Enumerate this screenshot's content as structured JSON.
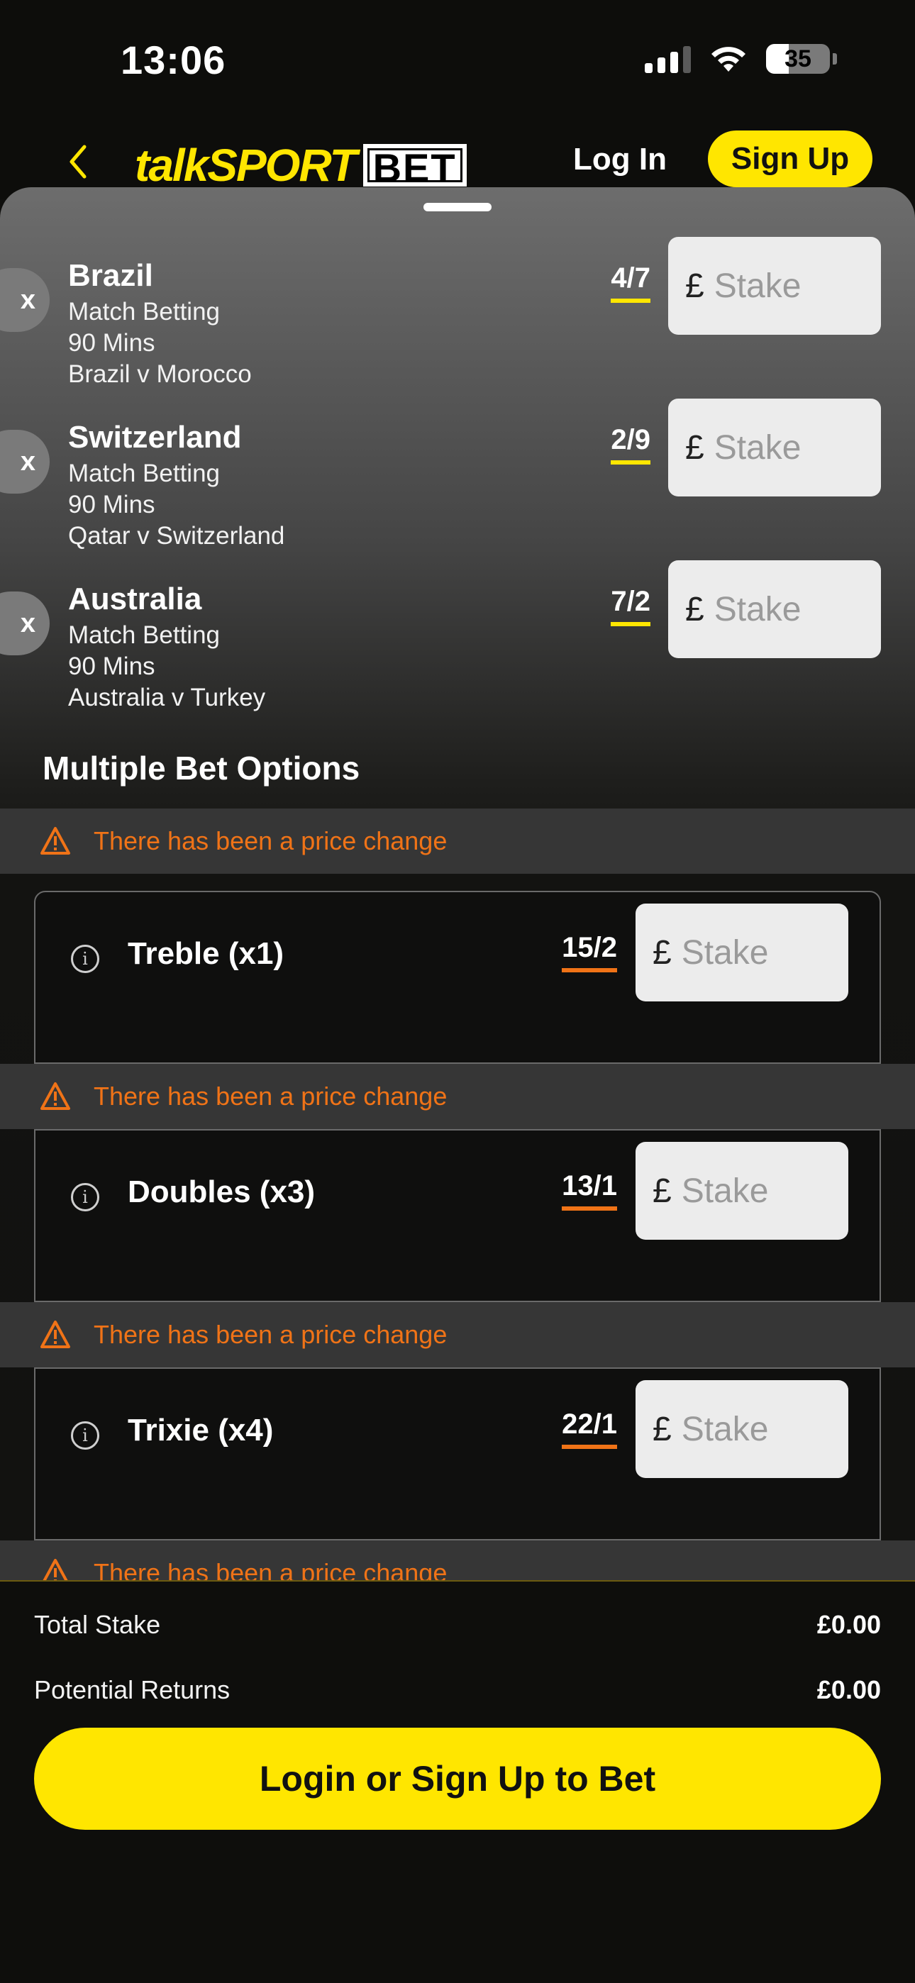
{
  "status_bar": {
    "time": "13:06",
    "battery": "35"
  },
  "header": {
    "back_icon": "chevron-left-icon",
    "logo_talk": "talkSPORT",
    "logo_bet": "BET",
    "login": "Log In",
    "signup": "Sign Up"
  },
  "colors": {
    "brand_yellow": "#ffe600",
    "warning_orange": "#f07317",
    "background": "#0e0e0c"
  },
  "selections": [
    {
      "team": "Brazil",
      "market": "Match Betting",
      "period": "90 Mins",
      "event": "Brazil v Morocco",
      "odds": "4/7",
      "remove": "x",
      "stake_symbol": "£",
      "stake_placeholder": "Stake"
    },
    {
      "team": "Switzerland",
      "market": "Match Betting",
      "period": "90 Mins",
      "event": "Qatar v Switzerland",
      "odds": "2/9",
      "remove": "x",
      "stake_symbol": "£",
      "stake_placeholder": "Stake"
    },
    {
      "team": "Australia",
      "market": "Match Betting",
      "period": "90 Mins",
      "event": "Australia v Turkey",
      "odds": "7/2",
      "remove": "x",
      "stake_symbol": "£",
      "stake_placeholder": "Stake"
    }
  ],
  "multiples": {
    "title": "Multiple Bet Options",
    "warning_text": "There has been a price change",
    "bets": [
      {
        "name": "Treble (x1)",
        "odds": "15/2",
        "stake_symbol": "£",
        "stake_placeholder": "Stake"
      },
      {
        "name": "Doubles (x3)",
        "odds": "13/1",
        "stake_symbol": "£",
        "stake_placeholder": "Stake"
      },
      {
        "name": "Trixie (x4)",
        "odds": "22/1",
        "stake_symbol": "£",
        "stake_placeholder": "Stake"
      }
    ]
  },
  "footer": {
    "total_stake_label": "Total Stake",
    "total_stake_value": "£0.00",
    "potential_returns_label": "Potential Returns",
    "potential_returns_value": "£0.00",
    "cta": "Login or Sign Up to Bet"
  }
}
